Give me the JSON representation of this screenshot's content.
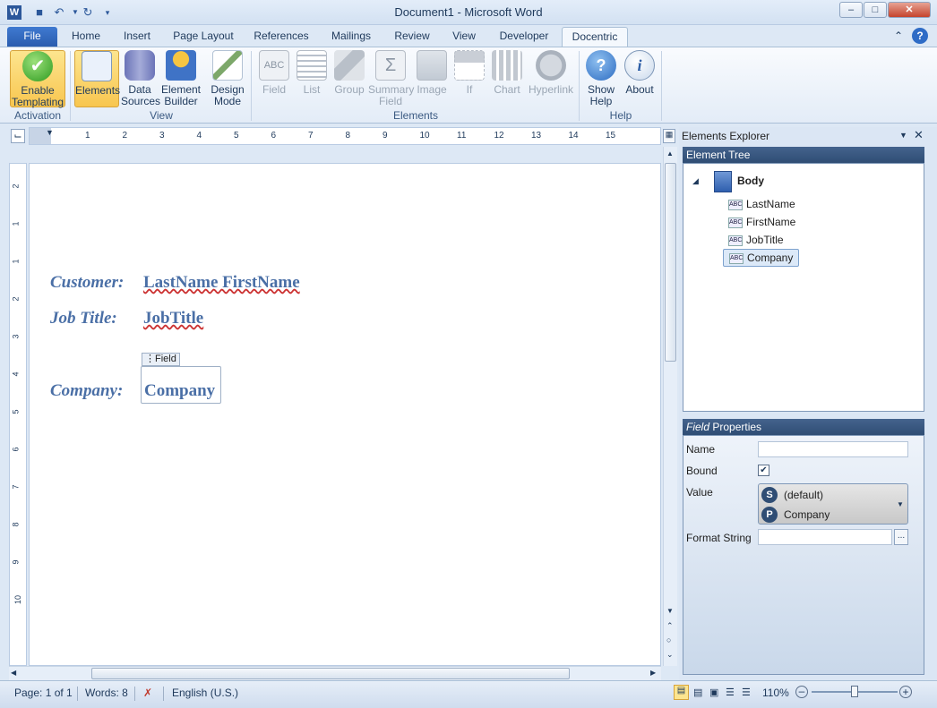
{
  "window": {
    "title": "Document1 - Microsoft Word"
  },
  "tabs": [
    "File",
    "Home",
    "Insert",
    "Page Layout",
    "References",
    "Mailings",
    "Review",
    "View",
    "Developer",
    "Docentric"
  ],
  "ribbon": {
    "activation": {
      "label": "Activation",
      "buttons": [
        {
          "label1": "Enable",
          "label2": "Templating"
        }
      ]
    },
    "view": {
      "label": "View",
      "buttons": [
        {
          "label1": "Elements",
          "label2": ""
        },
        {
          "label1": "Data",
          "label2": "Sources"
        },
        {
          "label1": "Element",
          "label2": "Builder"
        },
        {
          "label1": "Design",
          "label2": "Mode"
        }
      ]
    },
    "elements": {
      "label": "Elements",
      "buttons": [
        {
          "label1": "Field",
          "label2": ""
        },
        {
          "label1": "List",
          "label2": ""
        },
        {
          "label1": "Group",
          "label2": ""
        },
        {
          "label1": "Summary",
          "label2": "Field"
        },
        {
          "label1": "Image",
          "label2": ""
        },
        {
          "label1": "If",
          "label2": ""
        },
        {
          "label1": "Chart",
          "label2": ""
        },
        {
          "label1": "Hyperlink",
          "label2": ""
        }
      ]
    },
    "help": {
      "label": "Help",
      "buttons": [
        {
          "label1": "Show",
          "label2": "Help"
        },
        {
          "label1": "About",
          "label2": ""
        }
      ]
    }
  },
  "document": {
    "customer_label": "Customer:",
    "customer_value": "LastName FirstName",
    "jobtitle_label": "Job Title:",
    "jobtitle_value": "JobTitle",
    "company_label": "Company:",
    "company_value": "Company",
    "field_tag": "Field"
  },
  "explorer": {
    "title": "Elements Explorer",
    "tree_header": "Element Tree",
    "root": "Body",
    "items": [
      "LastName",
      "FirstName",
      "JobTitle",
      "Company"
    ],
    "props_header_italic": "Field",
    "props_header": "Properties",
    "props": {
      "name_label": "Name",
      "bound_label": "Bound",
      "value_label": "Value",
      "value_s": "(default)",
      "value_p": "Company",
      "format_label": "Format String",
      "ellipsis": "..."
    }
  },
  "status": {
    "page": "Page: 1 of 1",
    "words": "Words: 8",
    "language": "English (U.S.)",
    "zoom": "110%"
  },
  "ruler_numbers": [
    "1",
    "2",
    "3",
    "4",
    "5",
    "6",
    "7",
    "8",
    "9",
    "10",
    "11",
    "12",
    "13",
    "14",
    "15"
  ],
  "vruler_numbers": [
    "2",
    "1",
    "1",
    "2",
    "3",
    "4",
    "5",
    "6",
    "7",
    "8",
    "9",
    "10"
  ]
}
